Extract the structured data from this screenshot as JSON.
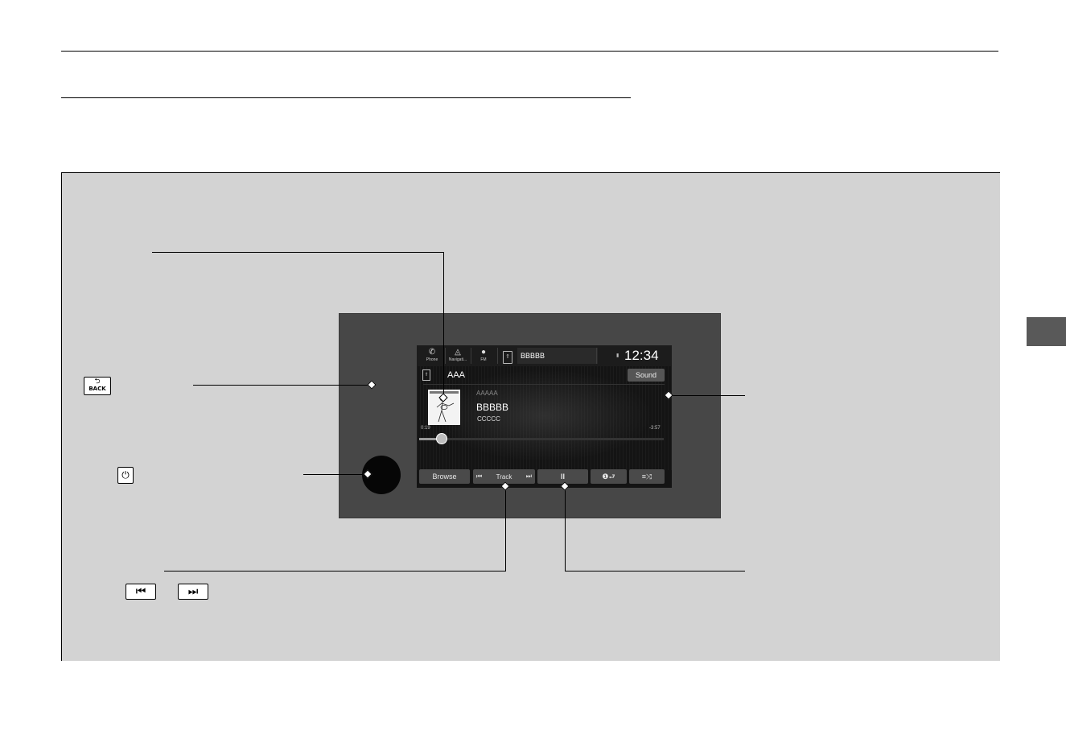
{
  "screen": {
    "top_tabs": [
      {
        "label": "Phone",
        "icon": "phone-icon"
      },
      {
        "label": "Navigati...",
        "icon": "navigation-icon"
      },
      {
        "label": "FM",
        "icon": "fm-radio-icon"
      }
    ],
    "now_playing_source": "BBBBB",
    "clock": "12:34",
    "source_title": "AAA",
    "sound_button": "Sound",
    "track": {
      "artist": "AAAAA",
      "title": "BBBBB",
      "album": "CCCCC",
      "elapsed": "0:19",
      "remaining": "-3:57",
      "progress_fraction": 0.09
    },
    "controls": {
      "browse": "Browse",
      "track": "Track",
      "pause": "II",
      "repeat_icon": "repeat-one-icon",
      "shuffle_icon": "shuffle-icon"
    }
  },
  "callouts": {
    "back_key": "BACK",
    "power_key_icon": "power-icon",
    "skip_back_icon": "skip-back-icon",
    "skip_forward_icon": "skip-forward-icon"
  },
  "colors": {
    "panel": "#d3d3d3",
    "unit_frame": "#474747",
    "screen_bg": "#141414",
    "side_tab": "#595959"
  }
}
